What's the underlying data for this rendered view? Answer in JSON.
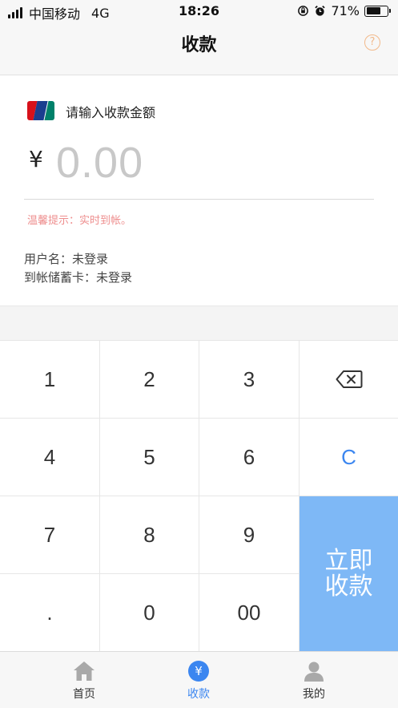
{
  "status_bar": {
    "carrier": "中国移动",
    "network": "4G",
    "time": "18:26",
    "battery": "71%",
    "battery_level": 0.71
  },
  "nav": {
    "title": "收款",
    "help_glyph": "?"
  },
  "payment": {
    "amount_label": "请输入收款金额",
    "currency_symbol": "¥",
    "amount_placeholder": "0.00",
    "tip": "温馨提示：实时到帐。",
    "username_line": "用户名：未登录",
    "card_line": "到帐储蓄卡：未登录"
  },
  "keypad": {
    "k1": "1",
    "k2": "2",
    "k3": "3",
    "k4": "4",
    "k5": "5",
    "k6": "6",
    "k7": "7",
    "k8": "8",
    "k9": "9",
    "kdot": ".",
    "k0": "0",
    "k00": "00",
    "clear": "C",
    "submit_line1": "立即",
    "submit_line2": "收款"
  },
  "tabs": [
    {
      "label": "首页",
      "icon": "home-icon"
    },
    {
      "label": "收款",
      "icon": "yen-icon",
      "glyph": "¥"
    },
    {
      "label": "我的",
      "icon": "person-icon"
    }
  ],
  "colors": {
    "accent": "#3b86f0",
    "submit_bg": "#7eb8f6",
    "tip": "#ee8e8e",
    "help": "#f2b98a"
  }
}
